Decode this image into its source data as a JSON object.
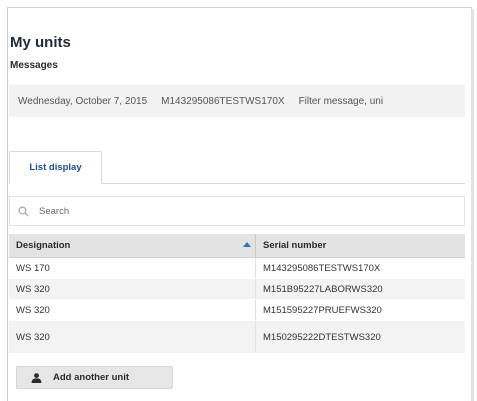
{
  "page": {
    "title": "My units",
    "messages_heading": "Messages"
  },
  "message": {
    "date": "Wednesday, October 7, 2015",
    "unit": "M143295086TESTWS170X",
    "text": "Filter message, uni"
  },
  "tabs": [
    {
      "label": "List display",
      "active": true
    }
  ],
  "search": {
    "placeholder": "Search",
    "value": "",
    "icon": "search-icon"
  },
  "table": {
    "columns": [
      "Designation",
      "Serial number"
    ],
    "sorted_column": "Designation",
    "sort_direction": "ascending",
    "rows": [
      {
        "designation": "WS 170",
        "serial": "M143295086TESTWS170X"
      },
      {
        "designation": "WS 320",
        "serial": "M151B95227LABORWS320"
      },
      {
        "designation": "WS 320",
        "serial": "M151595227PRUEFWS320"
      },
      {
        "designation": "WS 320",
        "serial": "M150295222DTESTWS320"
      }
    ]
  },
  "actions": {
    "add_unit_label": "Add another unit",
    "add_unit_icon": "user-icon"
  },
  "colors": {
    "title": "#1f2b3a",
    "tab_text": "#1f4e8c",
    "sort_indicator": "#3b6fb6",
    "header_bg": "#e3e3e3",
    "stripe_bg": "#f3f3f3"
  }
}
